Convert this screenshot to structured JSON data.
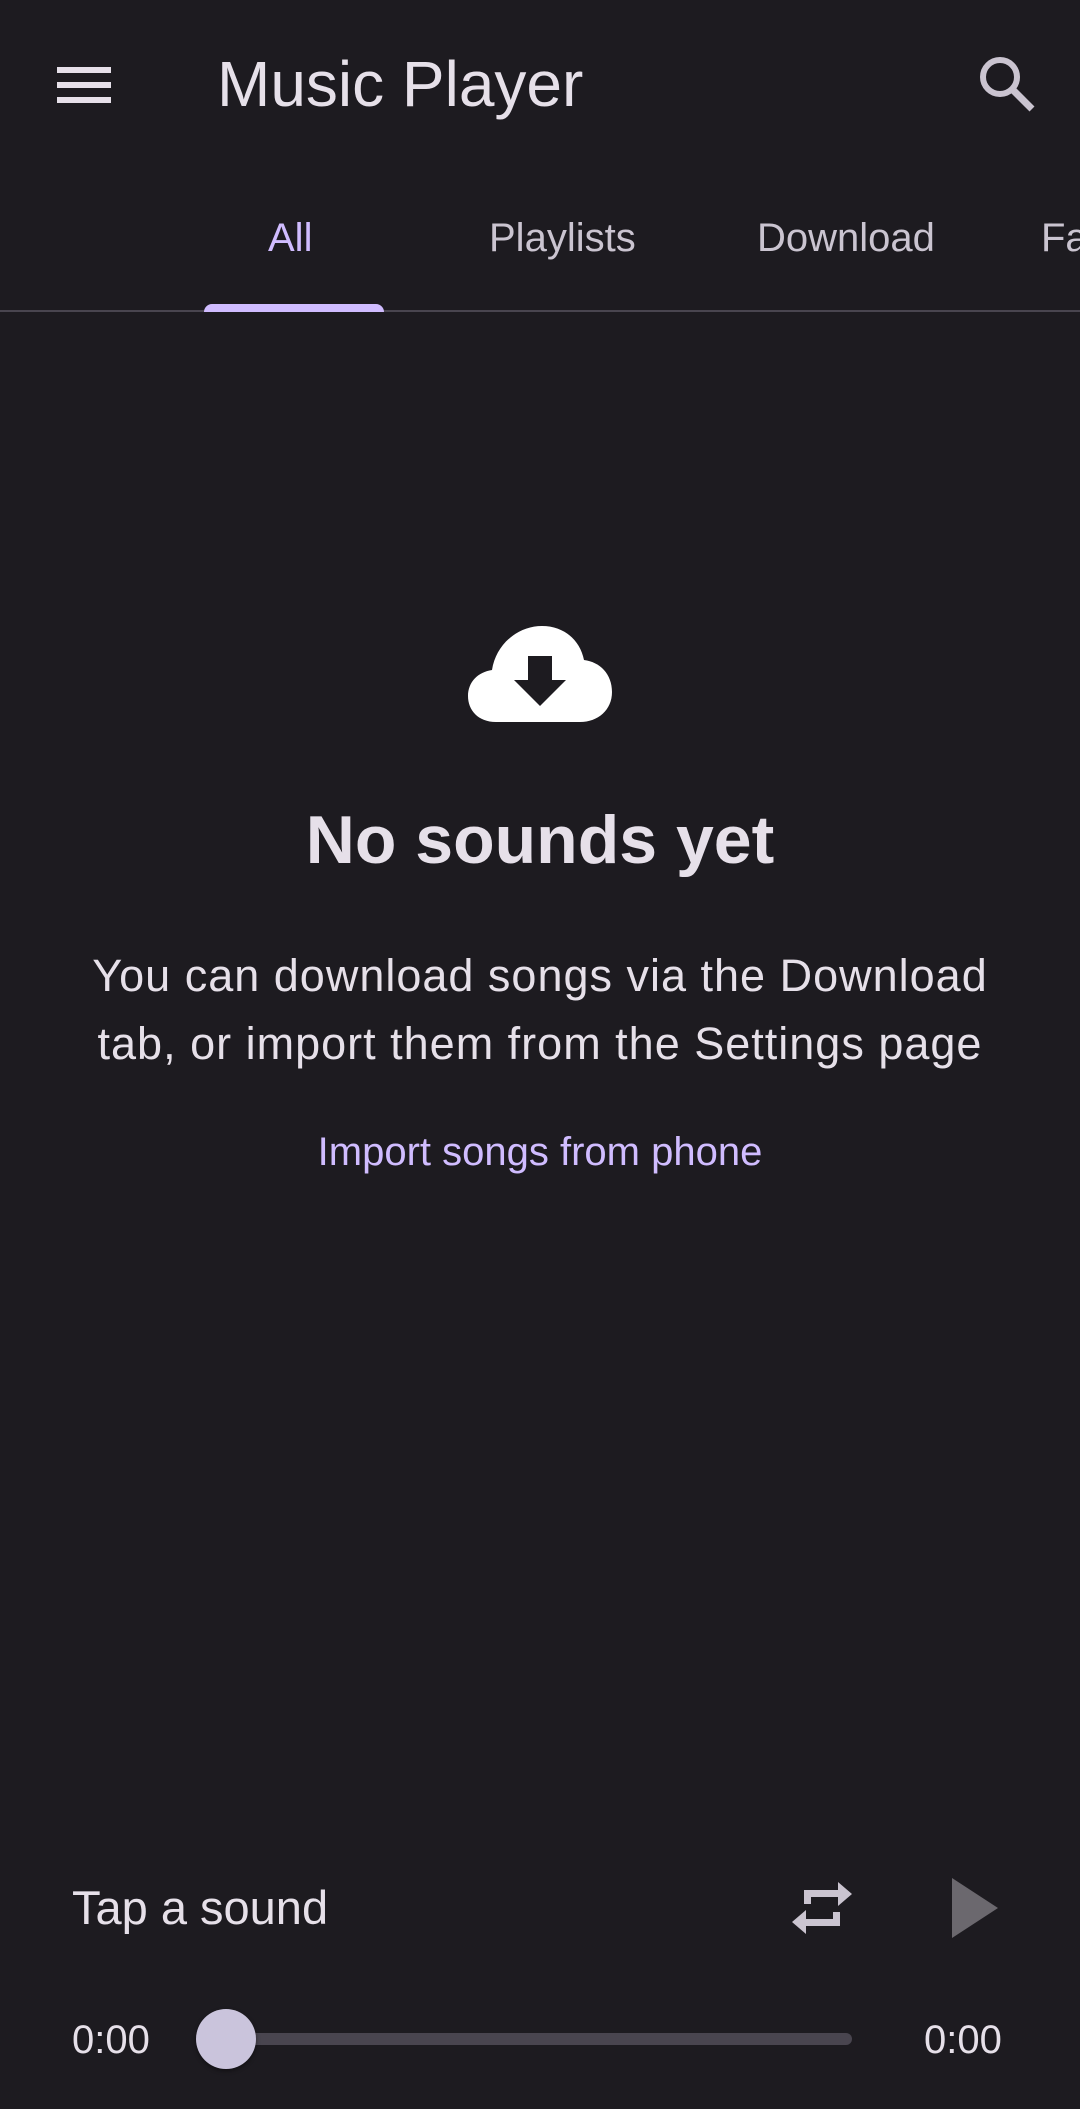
{
  "app": {
    "title": "Music Player",
    "menu_icon": "hamburger-menu-icon",
    "search_icon": "search-icon"
  },
  "tabs": [
    {
      "label": "All",
      "active": true
    },
    {
      "label": "Playlists",
      "active": false
    },
    {
      "label": "Download",
      "active": false
    },
    {
      "label": "Favorites",
      "active": false
    }
  ],
  "empty_state": {
    "icon": "cloud-download-icon",
    "heading": "No sounds yet",
    "description": "You can download songs via the Download tab, or import them from the Settings page",
    "action_label": "Import songs from phone"
  },
  "player": {
    "now_playing": "Tap a sound",
    "repeat_icon": "repeat-icon",
    "play_icon": "play-icon",
    "elapsed": "0:00",
    "duration": "0:00",
    "progress": 0
  },
  "colors": {
    "background": "#1d1b20",
    "accent": "#d0bcff",
    "on_surface": "#e6e0e9",
    "on_surface_variant": "#cac4d0",
    "divider": "#49454f",
    "disabled": "#6b686e"
  }
}
